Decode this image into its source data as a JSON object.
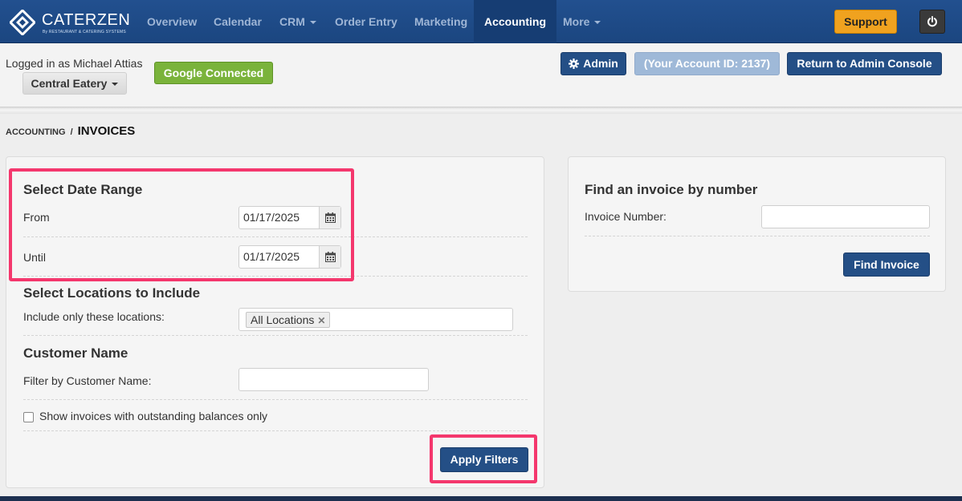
{
  "brand": {
    "name": "CATERZEN",
    "tagline": "By RESTAURANT & CATERING SYSTEMS"
  },
  "nav": {
    "items": [
      {
        "label": "Overview"
      },
      {
        "label": "Calendar"
      },
      {
        "label": "CRM"
      },
      {
        "label": "Order Entry"
      },
      {
        "label": "Marketing"
      },
      {
        "label": "Accounting"
      },
      {
        "label": "More"
      }
    ],
    "active": "Accounting",
    "support_label": "Support"
  },
  "header": {
    "logged_in_text": "Logged in as Michael Attias",
    "location_label": "Central Eatery",
    "google_label": "Google Connected",
    "admin_label": "Admin",
    "account_id_label": "(Your Account ID: 2137)",
    "return_label": "Return to Admin Console"
  },
  "breadcrumb": {
    "parent": "ACCOUNTING",
    "separator": "/",
    "current": "INVOICES"
  },
  "filters": {
    "date_range": {
      "title": "Select Date Range",
      "from_label": "From",
      "from_value": "01/17/2025",
      "until_label": "Until",
      "until_value": "01/17/2025"
    },
    "locations": {
      "title": "Select Locations to Include",
      "label": "Include only these locations:",
      "selected_tag": "All Locations"
    },
    "customer": {
      "title": "Customer Name",
      "label": "Filter by Customer Name:",
      "value": ""
    },
    "outstanding_checkbox_label": "Show invoices with outstanding balances only",
    "outstanding_checked": false,
    "apply_label": "Apply Filters"
  },
  "find_invoice": {
    "title": "Find an invoice by number",
    "label": "Invoice Number:",
    "value": "",
    "button_label": "Find Invoice"
  },
  "colors": {
    "navbar": "#1b4680",
    "primary_button": "#244f86",
    "support": "#f0a21f",
    "google": "#7ab33b",
    "highlight": "#f4376d"
  }
}
